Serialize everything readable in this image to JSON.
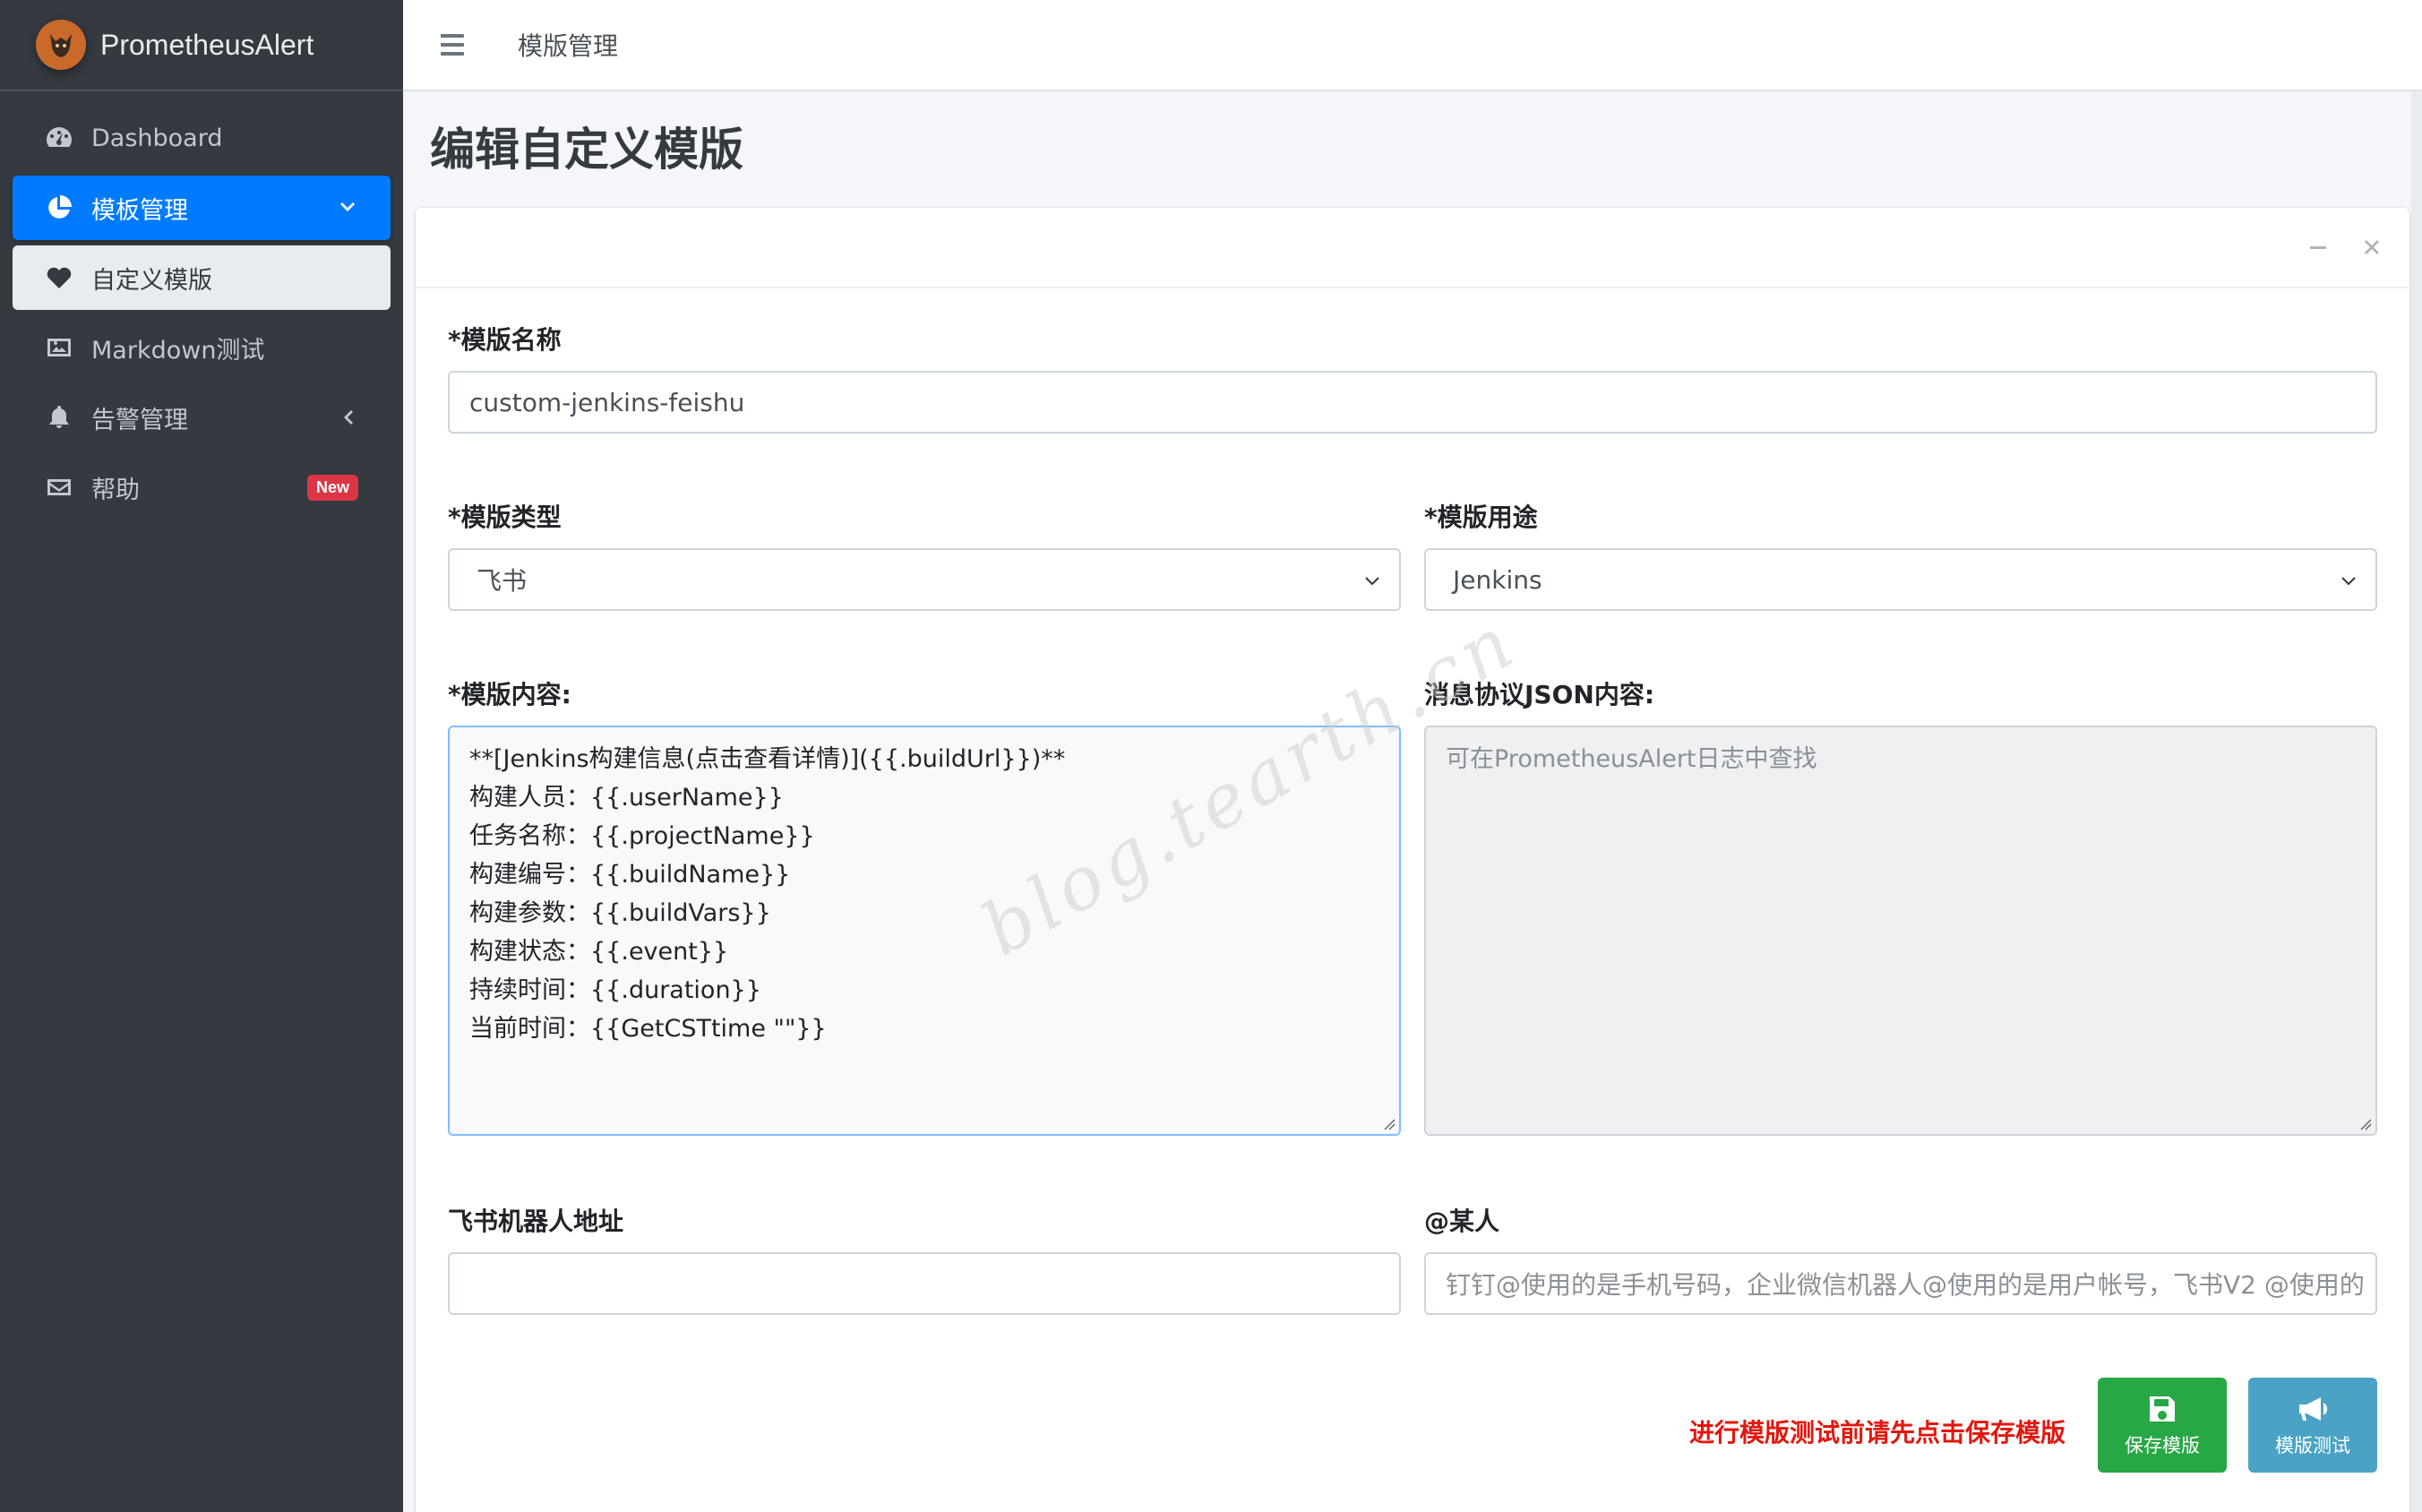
{
  "brand": {
    "name": "PrometheusAlert",
    "logo_icon": "fox-logo-icon"
  },
  "sidebar": {
    "items": [
      {
        "label": "Dashboard",
        "icon": "dashboard-icon",
        "state": "normal"
      },
      {
        "label": "模板管理",
        "icon": "pie-chart-icon",
        "state": "active",
        "chevron": "chevron-down-icon"
      },
      {
        "label": "自定义模版",
        "icon": "heart-icon",
        "state": "sub-active"
      },
      {
        "label": "Markdown测试",
        "icon": "image-icon",
        "state": "normal"
      },
      {
        "label": "告警管理",
        "icon": "bell-icon",
        "state": "normal",
        "chevron": "chevron-left-icon"
      },
      {
        "label": "帮助",
        "icon": "envelope-icon",
        "state": "normal",
        "badge": "New"
      }
    ]
  },
  "topbar": {
    "title": "模版管理",
    "menu_icon": "hamburger-icon"
  },
  "page": {
    "heading": "编辑自定义模版"
  },
  "form": {
    "name_label": "*模版名称",
    "name_value": "custom-jenkins-feishu",
    "type_label": "*模版类型",
    "type_value": "飞书",
    "usage_label": "*模版用途",
    "usage_value": "Jenkins",
    "content_label": "*模版内容:",
    "content_lines": [
      "**[Jenkins构建信息(点击查看详情)]({{.buildUrl}})**",
      "构建人员：{{.userName}}",
      "任务名称：{{.projectName}}",
      "构建编号：{{.buildName}}",
      "构建参数：{{.buildVars}}",
      "构建状态：{{.event}}",
      "持续时间：{{.duration}}",
      "当前时间：{{GetCSTtime \"\"}}"
    ],
    "json_label": "消息协议JSON内容:",
    "json_placeholder": "可在PrometheusAlert日志中查找",
    "robot_label": "飞书机器人地址",
    "robot_value": "",
    "at_label": "@某人",
    "at_placeholder": "钉钉@使用的是手机号码，企业微信机器人@使用的是用户帐号，飞书V2 @使用的"
  },
  "actions": {
    "warning": "进行模版测试前请先点击保存模版",
    "save_label": "保存模版",
    "test_label": "模版测试",
    "save_color": "#28a745",
    "test_color": "#4aa3c4"
  },
  "watermark": "blog.tearth.cn"
}
